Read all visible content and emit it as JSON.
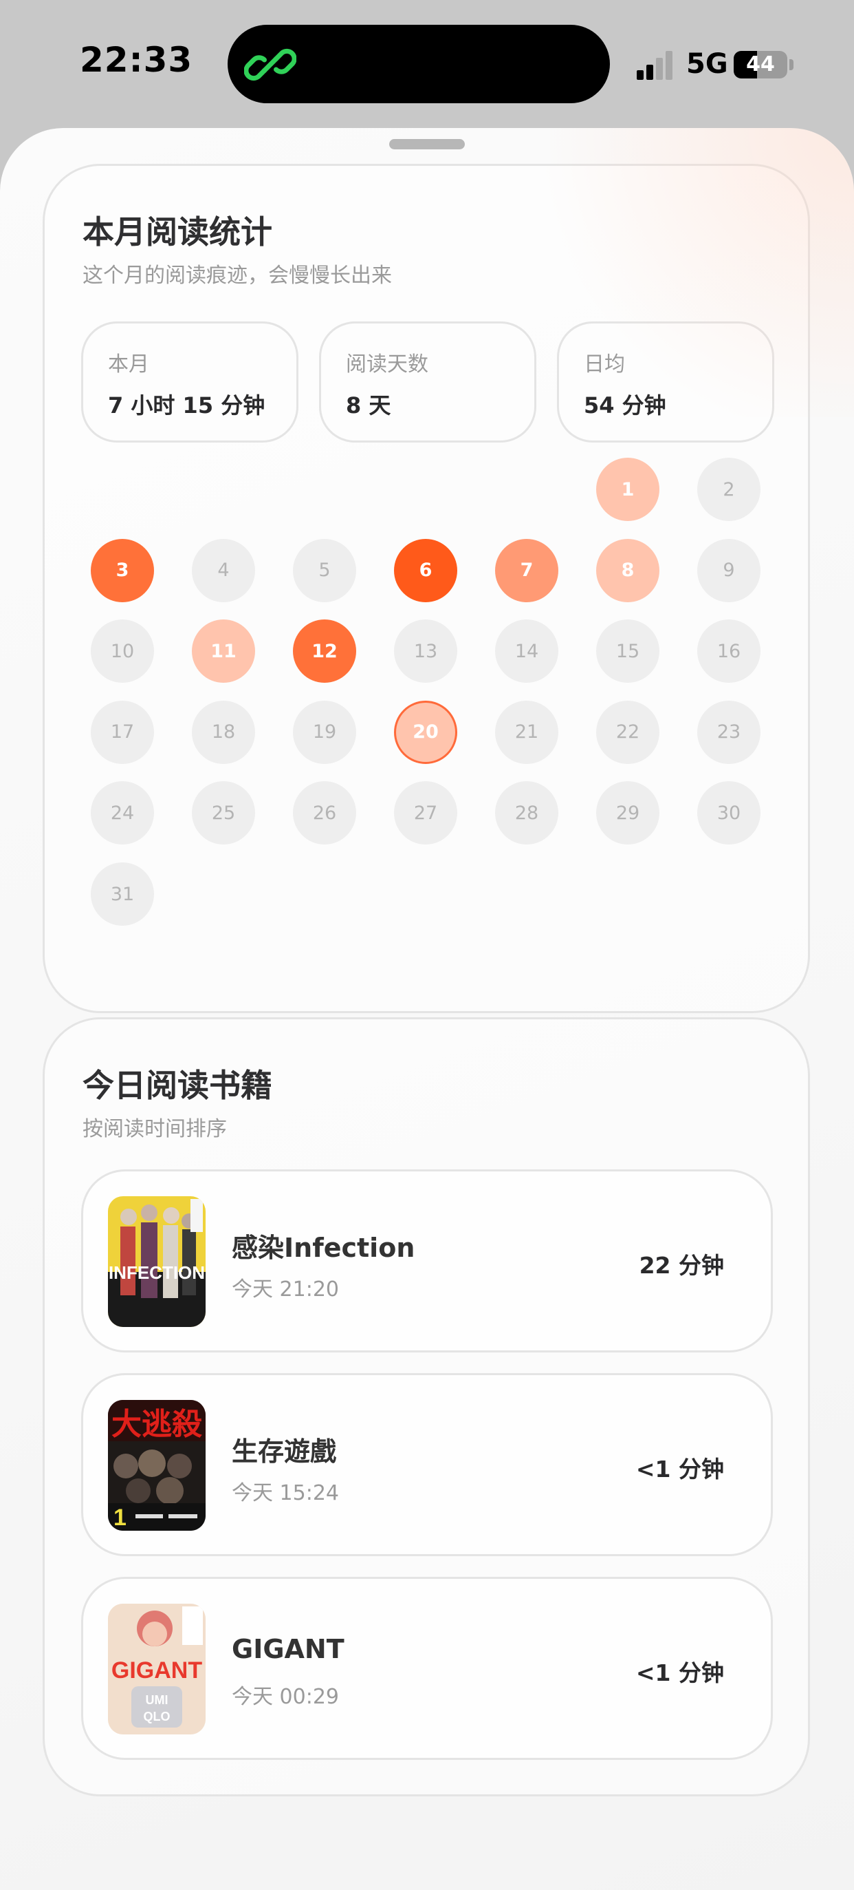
{
  "status_bar": {
    "time": "22:33",
    "network": "5G",
    "battery": "44",
    "battery_level_percent": 44,
    "island_icon": "link-app-icon",
    "island_icon_color": "#30d158"
  },
  "monthly_stats": {
    "title": "本月阅读统计",
    "subtitle": "这个月的阅读痕迹，会慢慢长出来",
    "stats": [
      {
        "label": "本月",
        "value": "7 小时 15 分钟"
      },
      {
        "label": "阅读天数",
        "value": "8 天"
      },
      {
        "label": "日均",
        "value": "54 分钟"
      }
    ],
    "calendar": {
      "first_weekday_index": 5,
      "today": 20,
      "days": [
        {
          "day": "1",
          "level": 1
        },
        {
          "day": "2",
          "level": 0
        },
        {
          "day": "3",
          "level": 3
        },
        {
          "day": "4",
          "level": 0
        },
        {
          "day": "5",
          "level": 0
        },
        {
          "day": "6",
          "level": 4
        },
        {
          "day": "7",
          "level": 2
        },
        {
          "day": "8",
          "level": 1
        },
        {
          "day": "9",
          "level": 0
        },
        {
          "day": "10",
          "level": 0
        },
        {
          "day": "11",
          "level": 1
        },
        {
          "day": "12",
          "level": 3
        },
        {
          "day": "13",
          "level": 0
        },
        {
          "day": "14",
          "level": 0
        },
        {
          "day": "15",
          "level": 0
        },
        {
          "day": "16",
          "level": 0
        },
        {
          "day": "17",
          "level": 0
        },
        {
          "day": "18",
          "level": 0
        },
        {
          "day": "19",
          "level": 0
        },
        {
          "day": "20",
          "level": 1
        },
        {
          "day": "21",
          "level": 0
        },
        {
          "day": "22",
          "level": 0
        },
        {
          "day": "23",
          "level": 0
        },
        {
          "day": "24",
          "level": 0
        },
        {
          "day": "25",
          "level": 0
        },
        {
          "day": "26",
          "level": 0
        },
        {
          "day": "27",
          "level": 0
        },
        {
          "day": "28",
          "level": 0
        },
        {
          "day": "29",
          "level": 0
        },
        {
          "day": "30",
          "level": 0
        },
        {
          "day": "31",
          "level": 0
        }
      ],
      "level_colors": [
        "#eeeeee",
        "#ffc4ad",
        "#ff9a74",
        "#ff7139",
        "#ff5a1a"
      ]
    }
  },
  "today_books": {
    "title": "今日阅读书籍",
    "subtitle": "按阅读时间排序",
    "books": [
      {
        "title": "感染Infection",
        "time": "今天 21:20",
        "duration": "22 分钟",
        "cover": "infection-cover"
      },
      {
        "title": "生存遊戲",
        "time": "今天 15:24",
        "duration": "<1 分钟",
        "cover": "battle-royale-cover"
      },
      {
        "title": "GIGANT",
        "time": "今天 00:29",
        "duration": "<1 分钟",
        "cover": "gigant-cover"
      }
    ]
  }
}
